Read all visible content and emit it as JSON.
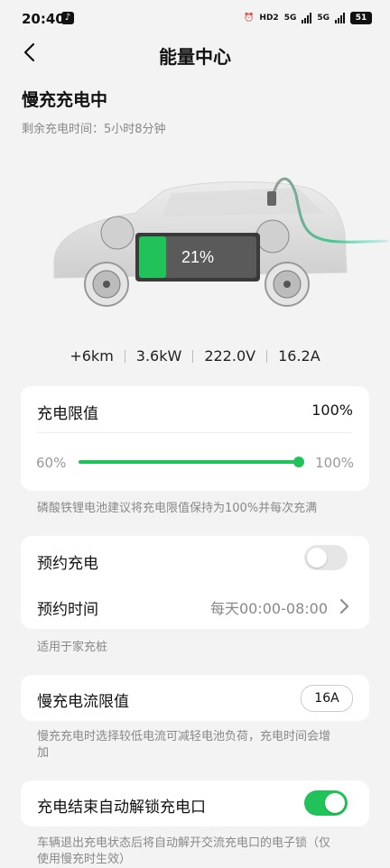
{
  "status_bar": {
    "time": "20:40",
    "battery": "51",
    "network_1": "5G",
    "network_2": "5G",
    "hd": "HD2"
  },
  "header": {
    "title": "能量中心"
  },
  "charging": {
    "status": "慢充充电中",
    "remaining_label": "剩余充电时间：5小时8分钟",
    "battery_percent_label": "21%",
    "battery_level": 0.21
  },
  "stats": [
    "+6km",
    "3.6kW",
    "222.0V",
    "16.2A"
  ],
  "charge_limit": {
    "label": "充电限值",
    "value": "100%",
    "min_label": "60%",
    "max_label": "100%",
    "level": 1.0,
    "note": "磷酸铁锂电池建议将充电限值保持为100%并每次充满"
  },
  "schedule": {
    "label": "预约充电",
    "enabled": false,
    "time_label": "预约时间",
    "time_value": "每天00:00-08:00",
    "note": "适用于家充桩"
  },
  "current_limit": {
    "label": "慢充电流限值",
    "value": "16A",
    "note_line1": "慢充充电时选择较低电流可减轻电池负荷，充电时间会增",
    "note_line2": "加"
  },
  "auto_unlock": {
    "label": "充电结束自动解锁充电口",
    "enabled": true,
    "note_line1": "车辆退出充电状态后将自动解开交流充电口的电子锁（仅",
    "note_line2": "使用慢充时生效）"
  },
  "colors": {
    "accent": "#21c25a",
    "toggle_off": "#e6e6e6",
    "text_secondary": "#888888"
  }
}
